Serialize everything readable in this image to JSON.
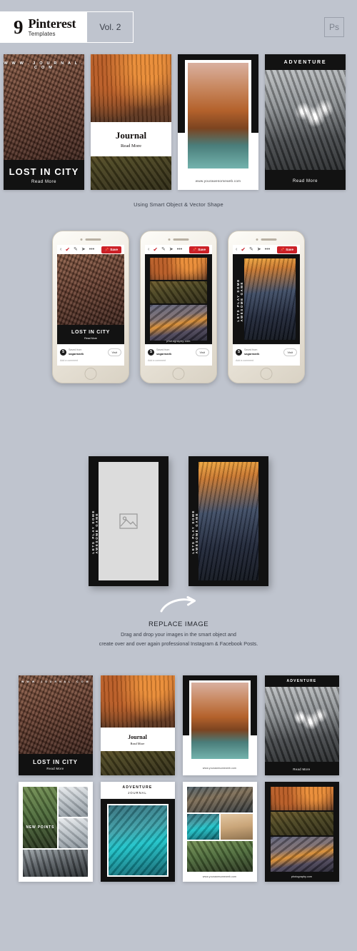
{
  "header": {
    "number": "9",
    "title": "Pinterest",
    "subtitle": "Templates",
    "volume": "Vol. 2",
    "software_badge": "Ps"
  },
  "section_showcase": {
    "caption": "Using Smart Object & Vector Shape",
    "templates": [
      {
        "id": "lost-in-city",
        "top_url": "W W W . J O U R N A L . C O M",
        "title": "LOST IN CITY",
        "cta": "Read More",
        "photo": "ph-city"
      },
      {
        "id": "journal",
        "title": "Journal",
        "cta": "Read More",
        "photo_top": "ph-autumn",
        "photo_bottom": "ph-hill"
      },
      {
        "id": "canal-frame",
        "url": "www.yourawesomeweb.com",
        "photo": "ph-canal"
      },
      {
        "id": "adventure",
        "title": "ADVENTURE",
        "cta": "Read More",
        "photo": "ph-jeep"
      }
    ]
  },
  "section_phones": {
    "phones": [
      {
        "toolbar": {
          "back": "‹",
          "check": "✔",
          "pencil": "✎",
          "send": "➤",
          "more": "•••",
          "save_label": "Save",
          "save_color": "#cc2127"
        },
        "post": {
          "title": "LOST IN CITY",
          "cta": "Read More",
          "photo": "ph-city",
          "layout": "single"
        },
        "footer": {
          "avatar_initial": "S",
          "line1": "Saved from",
          "line2": "sagarmarik",
          "visit_label": "Visit",
          "comment_placeholder": "Add a comment"
        }
      },
      {
        "toolbar": {
          "back": "‹",
          "check": "✔",
          "pencil": "✎",
          "send": "➤",
          "more": "•••",
          "save_label": "Save",
          "save_color": "#cc2127"
        },
        "post": {
          "url": "photography.com",
          "layout": "collage-3",
          "photos": [
            "ph-autumn",
            "ph-hill",
            "ph-peaks"
          ]
        },
        "footer": {
          "avatar_initial": "S",
          "line1": "Saved from",
          "line2": "sagarmarik",
          "visit_label": "Visit",
          "comment_placeholder": "Add a comment"
        }
      },
      {
        "toolbar": {
          "back": "‹",
          "check": "✔",
          "pencil": "✎",
          "send": "➤",
          "more": "•••",
          "save_label": "Save",
          "save_color": "#cc2127"
        },
        "post": {
          "vertical_text": "LETS PLAY SOME AWESOME GAME",
          "layout": "vertical-label",
          "photo": "ph-street"
        },
        "footer": {
          "avatar_initial": "S",
          "line1": "Saved from",
          "line2": "sagarmarik",
          "visit_label": "Visit",
          "comment_placeholder": "Add a comment"
        }
      }
    ]
  },
  "section_replace": {
    "card_left": {
      "vertical_text": "LETS PLAY SOME AWESOME GAME",
      "placeholder_icon": "image-placeholder-icon"
    },
    "card_right": {
      "vertical_text": "LETS PLAY SOME AWESOME GAME",
      "photo": "ph-street"
    },
    "arrow_icon": "curved-arrow-icon",
    "title": "REPLACE IMAGE",
    "line1": "Drag and drop your images in the smart object and",
    "line2": "create over and over again professional Instagram & Facebook Posts."
  },
  "section_grid": {
    "cells": [
      {
        "id": "grid-lost-in-city",
        "top_url": "W W W . J O U R N A L . C O M",
        "title": "LOST IN CITY",
        "cta": "Read More",
        "photo": "ph-city"
      },
      {
        "id": "grid-journal",
        "title": "Journal",
        "cta": "Read More",
        "photo_top": "ph-autumn",
        "photo_bottom": "ph-hill"
      },
      {
        "id": "grid-canal",
        "url": "www.yourawesomeweb.com",
        "photo": "ph-canal"
      },
      {
        "id": "grid-adventure",
        "title": "ADVENTURE",
        "cta": "Read More",
        "photo": "ph-jeep"
      },
      {
        "id": "grid-new-points",
        "overlay": "NEW POINTS",
        "photos": [
          "ph-green",
          "ph-snow",
          "ph-road"
        ]
      },
      {
        "id": "grid-adventure-journal",
        "title": "ADVENTURE",
        "subtitle": "JOURNAL",
        "photo": "ph-teal"
      },
      {
        "id": "grid-awesome-web",
        "url": "www.yourawesomeweb.com",
        "photos": [
          "ph-cliff",
          "ph-teal",
          "ph-sand",
          "ph-green"
        ]
      },
      {
        "id": "grid-photography",
        "url": "photography.com",
        "photos": [
          "ph-autumn",
          "ph-hill",
          "ph-peaks"
        ]
      }
    ]
  },
  "colors": {
    "page_background": "#bfc4ce",
    "dark_band": "#121212",
    "accent_red": "#cc2127",
    "white": "#ffffff"
  }
}
